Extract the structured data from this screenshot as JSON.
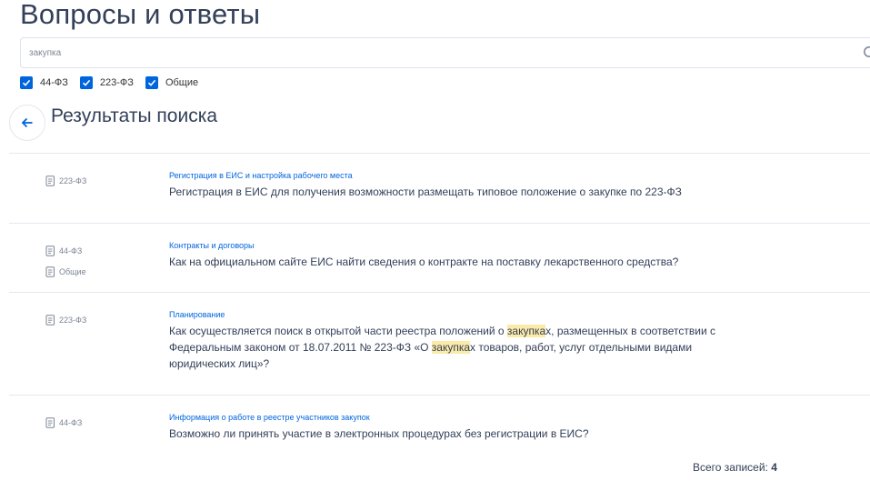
{
  "page": {
    "title": "Вопросы и ответы"
  },
  "search": {
    "value": "закупка"
  },
  "filters": [
    {
      "label": "44-ФЗ",
      "checked": true
    },
    {
      "label": "223-ФЗ",
      "checked": true
    },
    {
      "label": "Общие",
      "checked": true
    }
  ],
  "results_section": {
    "title": "Результаты поиска"
  },
  "results": [
    {
      "tags": [
        "223-ФЗ"
      ],
      "category": "Регистрация в ЕИС и настройка рабочего места",
      "question": "Регистрация в ЕИС для получения возможности размещать типовое положение о закупке по 223-ФЗ"
    },
    {
      "tags": [
        "44-ФЗ",
        "Общие"
      ],
      "category": "Контракты и договоры",
      "question": "Как на официальном сайте ЕИС найти сведения о контракте на поставку лекарственного средства?"
    },
    {
      "tags": [
        "223-ФЗ"
      ],
      "category": "Планирование",
      "question_parts": [
        {
          "text": "Как осуществляется поиск в открытой части реестра положений о ",
          "highlight": false
        },
        {
          "text": "закупка",
          "highlight": true
        },
        {
          "text": "х, размещенных в соответствии с Федеральным законом от 18.07.2011 № 223-ФЗ «О ",
          "highlight": false
        },
        {
          "text": "закупка",
          "highlight": true
        },
        {
          "text": "х товаров, работ, услуг отдельными видами юридических лиц»?",
          "highlight": false
        }
      ]
    },
    {
      "tags": [
        "44-ФЗ"
      ],
      "category": "Информация о работе в реестре участников закупок",
      "question": "Возможно ли принять участие в электронных процедурах без регистрации в ЕИС?"
    }
  ],
  "total": {
    "label": "Всего записей:",
    "count": "4"
  },
  "colors": {
    "accent": "#0065dd",
    "heading": "#334059",
    "highlight": "#fbeaa8",
    "border": "#e3e7ee"
  },
  "icons": [
    "search-icon",
    "checkmark-icon",
    "arrow-left-icon",
    "document-icon"
  ]
}
